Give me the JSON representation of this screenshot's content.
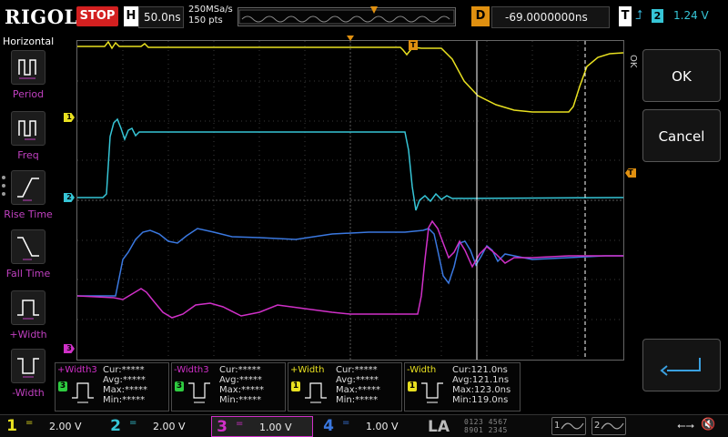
{
  "topbar": {
    "logo": "RIGOL",
    "run_state": "STOP",
    "horizontal_label": "H",
    "timebase": "50.0ns",
    "sample_rate": "250MSa/s",
    "memory_depth": "150 pts",
    "delay_label": "D",
    "delay_value": "-69.0000000ns",
    "trigger_label": "T",
    "trigger_edge_icon": "rising-edge-icon",
    "trigger_source": "2",
    "trigger_level": "1.24 V"
  },
  "left_menu": {
    "title": "Horizontal",
    "items": [
      {
        "label": "Period",
        "icon": "period-icon"
      },
      {
        "label": "Freq",
        "icon": "freq-icon"
      },
      {
        "label": "Rise Time",
        "icon": "rise-time-icon"
      },
      {
        "label": "Fall Time",
        "icon": "fall-time-icon"
      },
      {
        "label": "+Width",
        "icon": "pos-width-icon"
      },
      {
        "label": "-Width",
        "icon": "neg-width-icon"
      }
    ]
  },
  "channels_markers": [
    {
      "label": "1",
      "color": "#e8e020"
    },
    {
      "label": "2",
      "color": "#36c5d6"
    },
    {
      "label": "3",
      "color": "#d030c8"
    }
  ],
  "trigger_marker": "T",
  "right_menu": {
    "tab_label": "OK",
    "ok_label": "OK",
    "cancel_label": "Cancel"
  },
  "measurements": [
    {
      "name": "+Width3",
      "channel": "3",
      "color": "#d030c8",
      "cur": "*****",
      "avg": "*****",
      "max": "*****",
      "min": "*****"
    },
    {
      "name": "-Width3",
      "channel": "3",
      "color": "#d030c8",
      "cur": "*****",
      "avg": "*****",
      "max": "*****",
      "min": "*****"
    },
    {
      "name": "+Width",
      "channel": "1",
      "color": "#e8e020",
      "cur": "*****",
      "avg": "*****",
      "max": "*****",
      "min": "*****"
    },
    {
      "name": "-Width",
      "channel": "1",
      "color": "#e8e020",
      "cur": "121.0ns",
      "avg": "121.1ns",
      "max": "123.0ns",
      "min": "119.0ns"
    }
  ],
  "stat_labels": {
    "cur": "Cur:",
    "avg": "Avg:",
    "max": "Max:",
    "min": "Min:"
  },
  "bottom": {
    "channels": [
      {
        "num": "1",
        "coupling": "=",
        "scale": "2.00 V",
        "color": "#e8e020"
      },
      {
        "num": "2",
        "coupling": "=",
        "scale": "2.00 V",
        "color": "#36c5d6"
      },
      {
        "num": "3",
        "coupling": "=",
        "scale": "1.00 V",
        "color": "#d030c8"
      },
      {
        "num": "4",
        "coupling": "=",
        "scale": "1.00 V",
        "color": "#3a78e0"
      }
    ],
    "la_label": "LA",
    "digital_row1": "0123 4567",
    "digital_row2": "8901 2345",
    "gen1_label": "1",
    "gen2_label": "2"
  },
  "colors": {
    "ch1": "#e8e020",
    "ch2": "#36c5d6",
    "ch3": "#d030c8",
    "ch4": "#3a78e0",
    "trigger": "#e09010",
    "menu_label": "#c040c0"
  }
}
